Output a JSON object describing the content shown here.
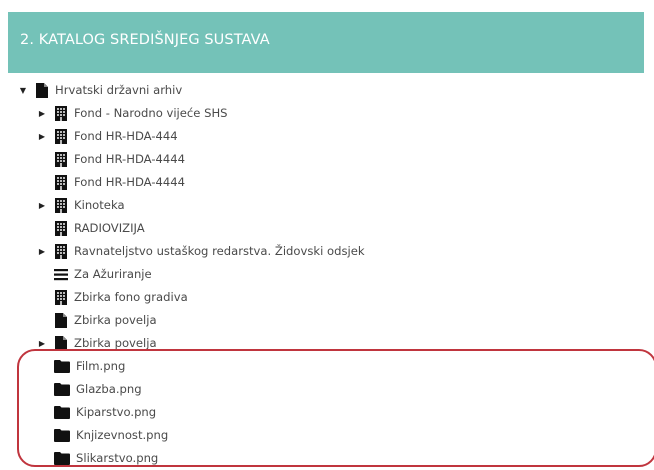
{
  "header": {
    "title": "2. KATALOG SREDIŠNJEG SUSTAVA"
  },
  "tree": {
    "root": {
      "label": "Hrvatski državni arhiv",
      "icon": "document-icon",
      "expanded": true
    },
    "children": [
      {
        "label": "Fond - Narodno vijeće SHS",
        "icon": "building-icon",
        "has_children": true
      },
      {
        "label": "Fond HR-HDA-444",
        "icon": "building-icon",
        "has_children": true
      },
      {
        "label": "Fond HR-HDA-4444",
        "icon": "building-icon",
        "has_children": false
      },
      {
        "label": "Fond HR-HDA-4444",
        "icon": "building-icon",
        "has_children": false
      },
      {
        "label": "Kinoteka",
        "icon": "building-icon",
        "has_children": true
      },
      {
        "label": "RADIOVIZIJA",
        "icon": "building-icon",
        "has_children": false
      },
      {
        "label": "Ravnateljstvo ustaškog redarstva. Židovski odsjek",
        "icon": "building-icon",
        "has_children": true
      },
      {
        "label": "Za Ažuriranje",
        "icon": "list-icon",
        "has_children": false
      },
      {
        "label": "Zbirka fono gradiva",
        "icon": "building-icon",
        "has_children": false
      },
      {
        "label": "Zbirka povelja",
        "icon": "document-icon",
        "has_children": false
      },
      {
        "label": "Zbirka povelja",
        "icon": "document-icon",
        "has_children": true
      },
      {
        "label": "Film.png",
        "icon": "folder-icon",
        "has_children": false
      },
      {
        "label": "Glazba.png",
        "icon": "folder-icon",
        "has_children": false
      },
      {
        "label": "Kiparstvo.png",
        "icon": "folder-icon",
        "has_children": false
      },
      {
        "label": "Knjizevnost.png",
        "icon": "folder-icon",
        "has_children": false
      },
      {
        "label": "Slikarstvo.png",
        "icon": "folder-icon",
        "has_children": false
      }
    ]
  },
  "colors": {
    "header_bg": "#74c2b8",
    "highlight_border": "#c0353e",
    "text": "#4a4a4a"
  }
}
